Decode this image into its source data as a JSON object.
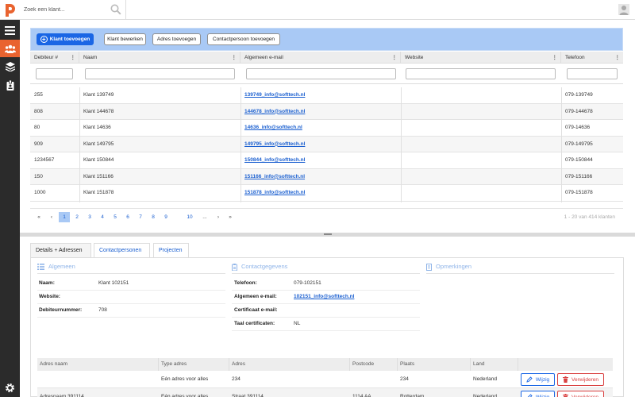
{
  "search": {
    "placeholder": "Zoek een klant..."
  },
  "toolbar": {
    "add_client": "Klant toevoegen",
    "edit_client": "Klant bewerken",
    "add_address": "Adres toevoegen",
    "add_contact": "Contactpersoon toevoegen"
  },
  "grid": {
    "columns": [
      "Debiteur #",
      "Naam",
      "Algemeen e-mail",
      "Website",
      "Telefoon"
    ],
    "rows": [
      {
        "debtor": "255",
        "name": "Klant 139749",
        "email": "139749_info@softtech.nl",
        "website": "",
        "phone": "079-139749"
      },
      {
        "debtor": "808",
        "name": "Klant 144678",
        "email": "144678_info@softtech.nl",
        "website": "",
        "phone": "079-144678"
      },
      {
        "debtor": "80",
        "name": "Klant 14636",
        "email": "14636_info@softtech.nl",
        "website": "",
        "phone": "079-14636"
      },
      {
        "debtor": "909",
        "name": "Klant 149795",
        "email": "149795_info@softtech.nl",
        "website": "",
        "phone": "079-149795"
      },
      {
        "debtor": "1234567",
        "name": "Klant 150844",
        "email": "150844_info@softtech.nl",
        "website": "",
        "phone": "079-150844"
      },
      {
        "debtor": "150",
        "name": "Klant 151166",
        "email": "151166_info@softtech.nl",
        "website": "",
        "phone": "079-151166"
      },
      {
        "debtor": "1000",
        "name": "Klant 151878",
        "email": "151878_info@softtech.nl",
        "website": "",
        "phone": "079-151878"
      }
    ]
  },
  "pager": {
    "first": "«",
    "prev": "‹",
    "pages": [
      "1",
      "2",
      "3",
      "4",
      "5",
      "6",
      "7",
      "8",
      "9",
      "10",
      "..."
    ],
    "current": "1",
    "next": "›",
    "last": "»",
    "info": "1 - 20 van 414 klanten"
  },
  "tabs": [
    "Details + Adressen",
    "Contactpersonen",
    "Projecten"
  ],
  "details": {
    "general": {
      "title": "Algemeen",
      "name_label": "Naam:",
      "name_value": "Klant 102151",
      "website_label": "Website:",
      "website_value": "",
      "debtor_label": "Debiteurnummer:",
      "debtor_value": "708"
    },
    "contact": {
      "title": "Contactgegevens",
      "phone_label": "Telefoon:",
      "phone_value": "079-102151",
      "email_label": "Algemeen e-mail:",
      "email_value": "102151_info@softtech.nl",
      "cert_email_label": "Certificaat e-mail:",
      "cert_email_value": "",
      "cert_lang_label": "Taal certificaten:",
      "cert_lang_value": "NL"
    },
    "remarks": {
      "title": "Opmerkingen"
    }
  },
  "addresses": {
    "columns": [
      "Adres naam",
      "Type adres",
      "Adres",
      "Postcode",
      "Plaats",
      "Land"
    ],
    "rows": [
      {
        "name": "",
        "type": "Eén adres voor alles",
        "address": "234",
        "postcode": "",
        "city": "234",
        "country": "Nederland"
      },
      {
        "name": "Adresnaam 391114",
        "type": "Eén adres voor alles",
        "address": "Straat 391114",
        "postcode": "1114 AA",
        "city": "Rotterdam",
        "country": "Nederland"
      }
    ],
    "edit_label": "Wijzig",
    "delete_label": "Verwijderen"
  },
  "colors": {
    "brand": "#e9632f",
    "primary": "#1a66e5",
    "toolbar_bg": "#a9c9f5",
    "sidebar_bg": "#2b2b2b",
    "danger": "#d94040"
  },
  "icons": [
    "logo-icon",
    "search-icon",
    "user-icon",
    "menu-icon",
    "clients-icon",
    "layers-icon",
    "badge-icon",
    "list-icon",
    "contact-card-icon",
    "remarks-icon",
    "pencil-icon",
    "trash-icon",
    "gear-icon"
  ]
}
